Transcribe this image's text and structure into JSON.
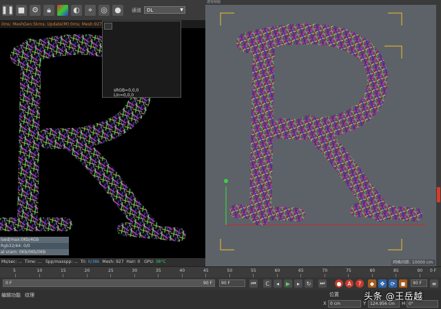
{
  "left_toolbar": {
    "channel_label": "通道",
    "channel_value": "DL",
    "buttons": [
      "pause-icon",
      "stop-icon",
      "settings-icon",
      "lock-icon",
      "color-swatch-icon",
      "globe-icon",
      "pin-icon",
      "target-icon",
      "sphere-icon"
    ]
  },
  "render_status": "ilms; MeshGen:5kms; Update(M):0ms; Mesh:927 Nodes:8466 Movable:927 0 0",
  "color_popup": {
    "srgb": "sRGB=0,0,0",
    "lin": "Lin=0,0,0"
  },
  "left_stats": {
    "line1": "ised/max:0Kb/4Gb",
    "line2": "Rgb32/64: 0/0",
    "line3": "al vram: 0Kb/0Kb/0Kb"
  },
  "left_infobar": {
    "ms": "Ms/sec: ...",
    "time": "Time: ...",
    "spp": "Spp/maxspp: ...",
    "tri": "Tri: ",
    "tri_val": "0/38k",
    "mesh": "Mesh: 927",
    "hair": "Hair: 0",
    "gpu": "GPU:",
    "gpu_val": "38°C"
  },
  "right_viewport": {
    "header": "透视视图",
    "footer": "网格间距: 10000 cm"
  },
  "timeline": {
    "ticks": [
      "5",
      "10",
      "15",
      "20",
      "25",
      "30",
      "35",
      "40",
      "45",
      "50",
      "55",
      "60",
      "65",
      "70",
      "75",
      "80",
      "85",
      "90"
    ],
    "end_label": "0 F"
  },
  "transport": {
    "range_start": "0 F",
    "range_end": "90 F",
    "frame_a": "90 F",
    "frame_b": "90 F"
  },
  "bottom_menu": [
    "编辑",
    "功能",
    "纹理"
  ],
  "coords": {
    "title": "位置",
    "x_label": "X",
    "x_value": "0 cm",
    "y_label": "Y",
    "y_value": "124.956 cm",
    "h_label": "H",
    "h_value": "0°"
  },
  "watermark": "头条 @王岳越",
  "colors": {
    "accent_red": "#d83b2a",
    "status_orange": "#e07a2a",
    "viewport_gray": "#5c6268"
  }
}
